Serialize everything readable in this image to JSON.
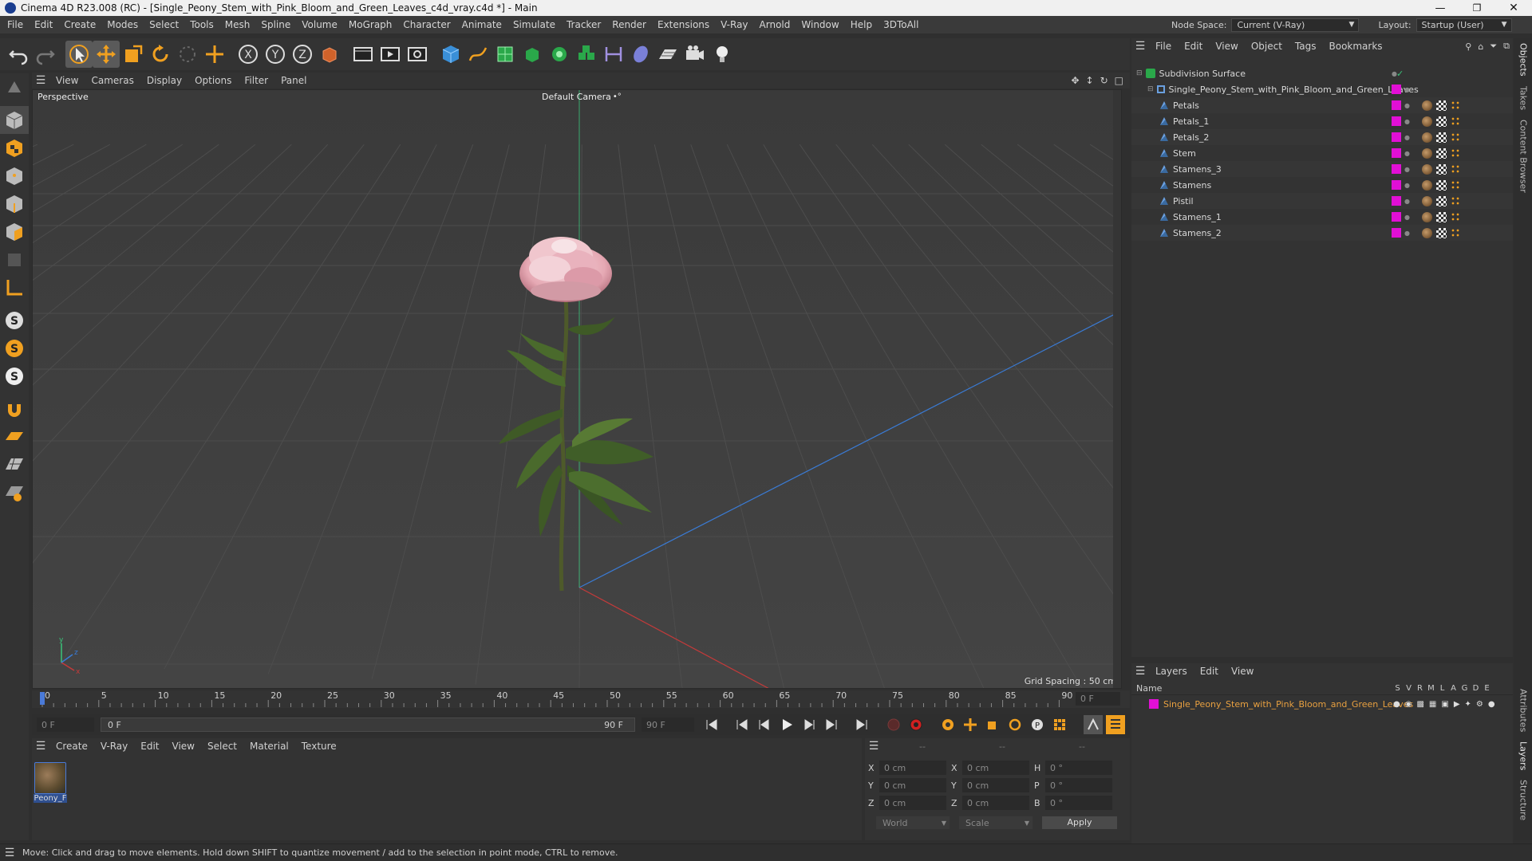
{
  "window": {
    "title": "Cinema 4D R23.008 (RC) - [Single_Peony_Stem_with_Pink_Bloom_and_Green_Leaves_c4d_vray.c4d *] - Main"
  },
  "menubar": {
    "items": [
      "File",
      "Edit",
      "Create",
      "Modes",
      "Select",
      "Tools",
      "Mesh",
      "Spline",
      "Volume",
      "MoGraph",
      "Character",
      "Animate",
      "Simulate",
      "Tracker",
      "Render",
      "Extensions",
      "V-Ray",
      "Arnold",
      "Window",
      "Help",
      "3DToAll"
    ],
    "node_space_label": "Node Space:",
    "node_space_value": "Current (V-Ray)",
    "layout_label": "Layout:",
    "layout_value": "Startup (User)"
  },
  "viewport": {
    "menu": [
      "View",
      "Cameras",
      "Display",
      "Options",
      "Filter",
      "Panel"
    ],
    "label": "Perspective",
    "camera": "Default Camera",
    "camera_icon": "•°",
    "grid_spacing": "Grid Spacing : 50 cm"
  },
  "timeline": {
    "ticks": [
      "0",
      "5",
      "10",
      "15",
      "20",
      "25",
      "30",
      "35",
      "40",
      "45",
      "50",
      "55",
      "60",
      "65",
      "70",
      "75",
      "80",
      "85",
      "90"
    ],
    "current_frame_right": "0 F",
    "start_field": "0 F",
    "range_start": "0 F",
    "range_end": "90 F",
    "end_field": "90 F"
  },
  "material_manager": {
    "menu": [
      "Create",
      "V-Ray",
      "Edit",
      "View",
      "Select",
      "Material",
      "Texture"
    ],
    "materials": [
      {
        "name": "Peony_F"
      }
    ]
  },
  "coordinates": {
    "headers": [
      "--",
      "--",
      "--"
    ],
    "rows": [
      {
        "a_label": "X",
        "a_value": "0 cm",
        "b_label": "X",
        "b_value": "0 cm",
        "c_label": "H",
        "c_value": "0 °"
      },
      {
        "a_label": "Y",
        "a_value": "0 cm",
        "b_label": "Y",
        "b_value": "0 cm",
        "c_label": "P",
        "c_value": "0 °"
      },
      {
        "a_label": "Z",
        "a_value": "0 cm",
        "b_label": "Z",
        "b_value": "0 cm",
        "c_label": "B",
        "c_value": "0 °"
      }
    ],
    "mode_world": "World",
    "mode_scale": "Scale",
    "apply_label": "Apply"
  },
  "object_manager": {
    "menu": [
      "File",
      "Edit",
      "View",
      "Object",
      "Tags",
      "Bookmarks"
    ],
    "root": "Subdivision Surface",
    "group": "Single_Peony_Stem_with_Pink_Bloom_and_Green_Leaves",
    "children": [
      "Petals",
      "Petals_1",
      "Petals_2",
      "Stem",
      "Stamens_3",
      "Stamens",
      "Pistil",
      "Stamens_1",
      "Stamens_2"
    ]
  },
  "layers_manager": {
    "menu": [
      "Layers",
      "Edit",
      "View"
    ],
    "name_header": "Name",
    "flags": [
      "S",
      "V",
      "R",
      "M",
      "L",
      "A",
      "G",
      "D",
      "E"
    ],
    "layer_name": "Single_Peony_Stem_with_Pink_Bloom_and_Green_Leaves"
  },
  "right_tabs": [
    "Objects",
    "Takes",
    "Content Browser"
  ],
  "right_tabs_lower": [
    "Attributes",
    "Layers",
    "Structure"
  ],
  "status_bar": {
    "text": "Move: Click and drag to move elements. Hold down SHIFT to quantize movement / add to the selection in point mode, CTRL to remove."
  },
  "colors": {
    "accent_magenta": "#e10fd5",
    "axis_x": "#c43a3a",
    "axis_z": "#3a7bd5",
    "axis_y": "#3ac47a",
    "layer_text": "#e8a040"
  }
}
